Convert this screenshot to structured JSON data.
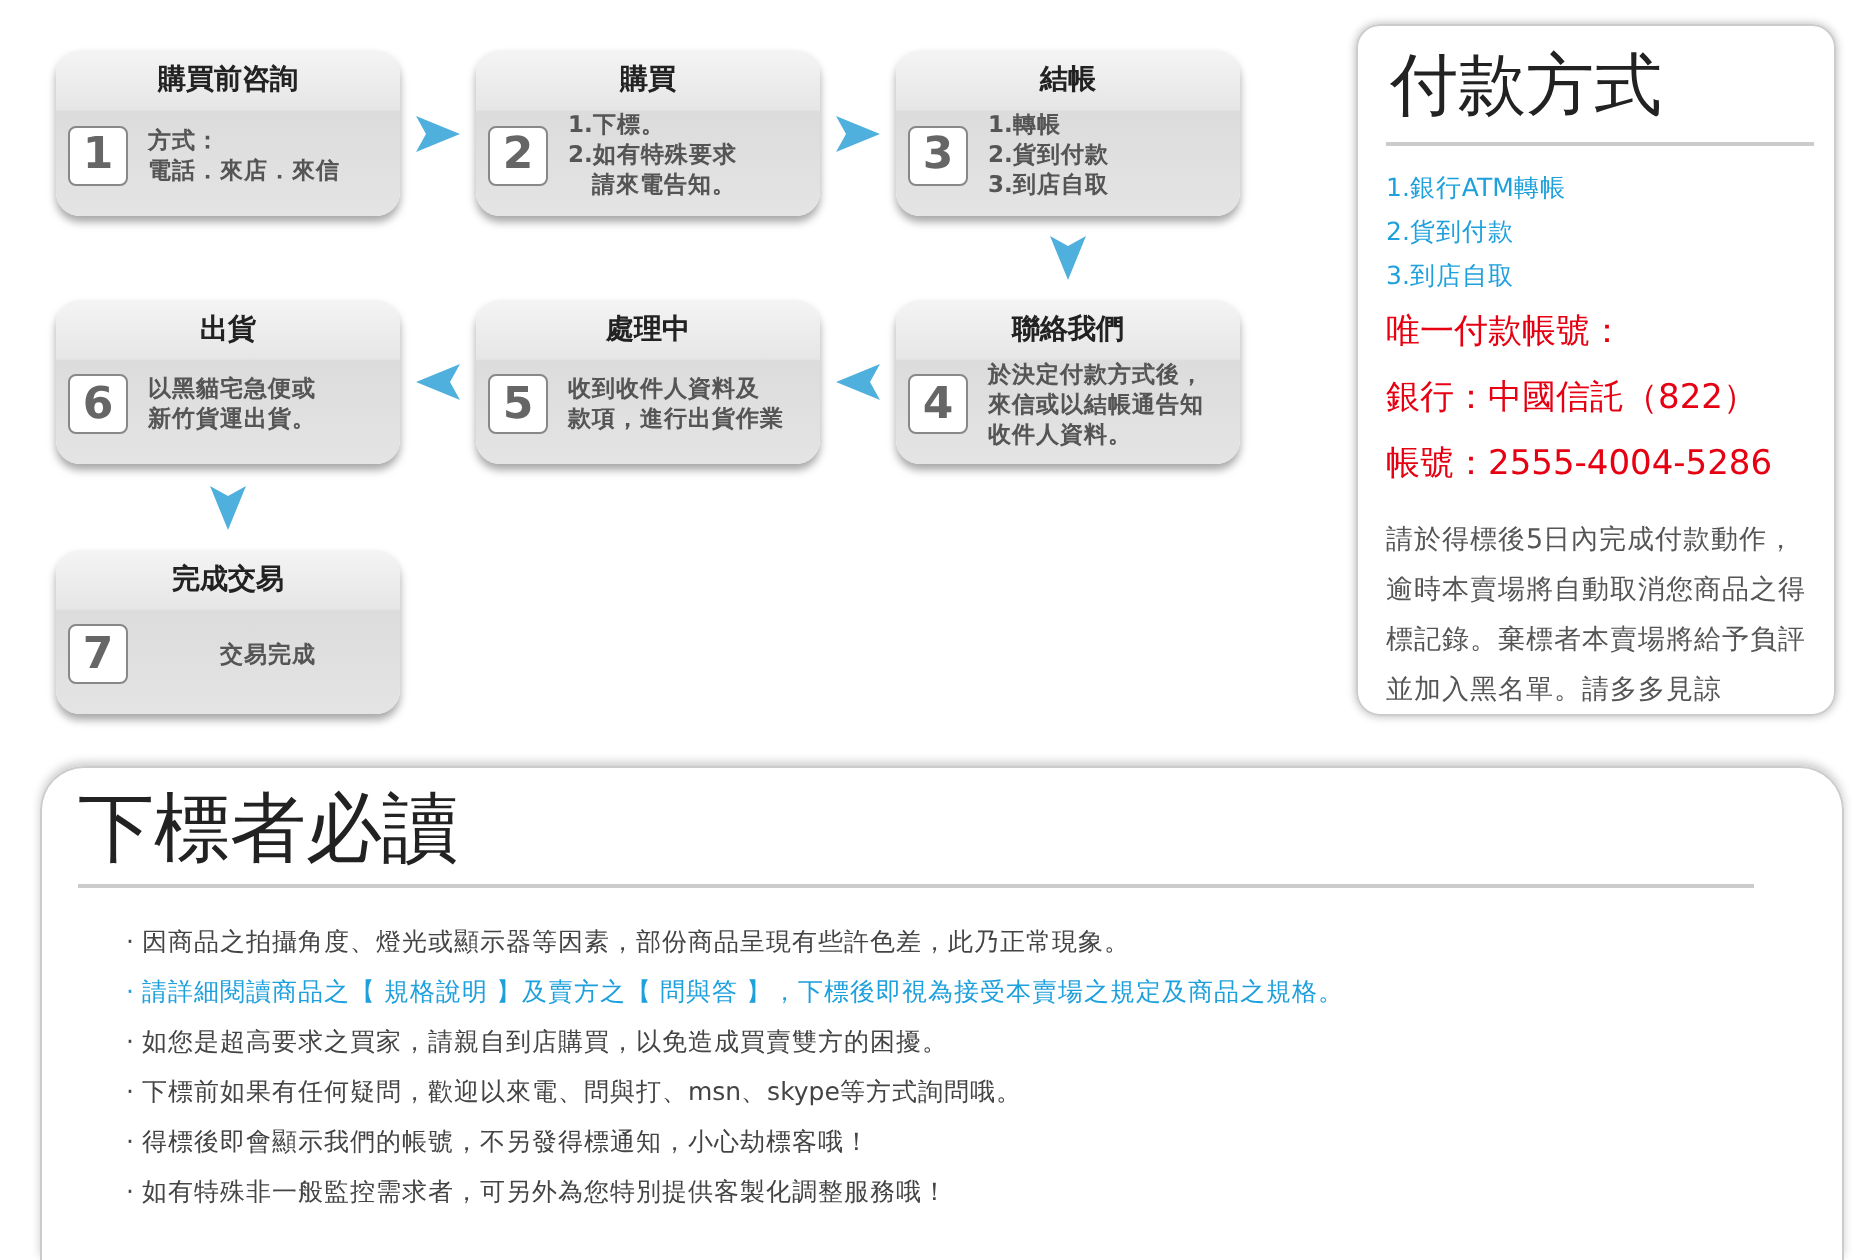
{
  "steps": [
    {
      "number": "1",
      "title": "購買前咨詢",
      "lines": [
        "方式：",
        "電話．來店．來信"
      ]
    },
    {
      "number": "2",
      "title": "購買",
      "lines": [
        "1.下標。",
        "2.如有特殊要求",
        "　請來電告知。"
      ]
    },
    {
      "number": "3",
      "title": "結帳",
      "lines": [
        "1.轉帳",
        "2.貨到付款",
        "3.到店自取"
      ]
    },
    {
      "number": "6",
      "title": "出貨",
      "lines": [
        "以黑貓宅急便或",
        "新竹貨運出貨。"
      ]
    },
    {
      "number": "5",
      "title": "處理中",
      "lines": [
        "收到收件人資料及",
        "款項，進行出貨作業"
      ]
    },
    {
      "number": "4",
      "title": "聯絡我們",
      "lines": [
        "於決定付款方式後，",
        "來信或以結帳通告知",
        "收件人資料。"
      ]
    },
    {
      "number": "7",
      "title": "完成交易",
      "lines": [
        "交易完成"
      ]
    }
  ],
  "payment": {
    "title": "付款方式",
    "methods": [
      "1.銀行ATM轉帳",
      "2.貨到付款",
      "3.到店自取"
    ],
    "account": [
      "唯一付款帳號：",
      "銀行：中國信託（822）",
      "帳號：2555-4004-5286"
    ],
    "note": "請於得標後5日內完成付款動作，逾時本賣場將自動取消您商品之得標記錄。棄標者本賣場將給予負評並加入黑名單。請多多見諒"
  },
  "notice": {
    "title": "下標者必讀",
    "items": [
      {
        "text": "· 因商品之拍攝角度、燈光或顯示器等因素，部份商品呈現有些許色差，此乃正常現象。",
        "highlight": false
      },
      {
        "text": "· 請詳細閱讀商品之【 規格說明 】及賣方之【 問與答 】，下標後即視為接受本賣場之規定及商品之規格。",
        "highlight": true
      },
      {
        "text": "· 如您是超高要求之買家，請親自到店購買，以免造成買賣雙方的困擾。",
        "highlight": false
      },
      {
        "text": "· 下標前如果有任何疑問，歡迎以來電、問與打、msn、skype等方式詢問哦。",
        "highlight": false
      },
      {
        "text": "· 得標後即會顯示我們的帳號，不另發得標通知，小心劫標客哦！",
        "highlight": false
      },
      {
        "text": "· 如有特殊非一般監控需求者，可另外為您特別提供客製化調整服務哦！",
        "highlight": false
      }
    ]
  }
}
